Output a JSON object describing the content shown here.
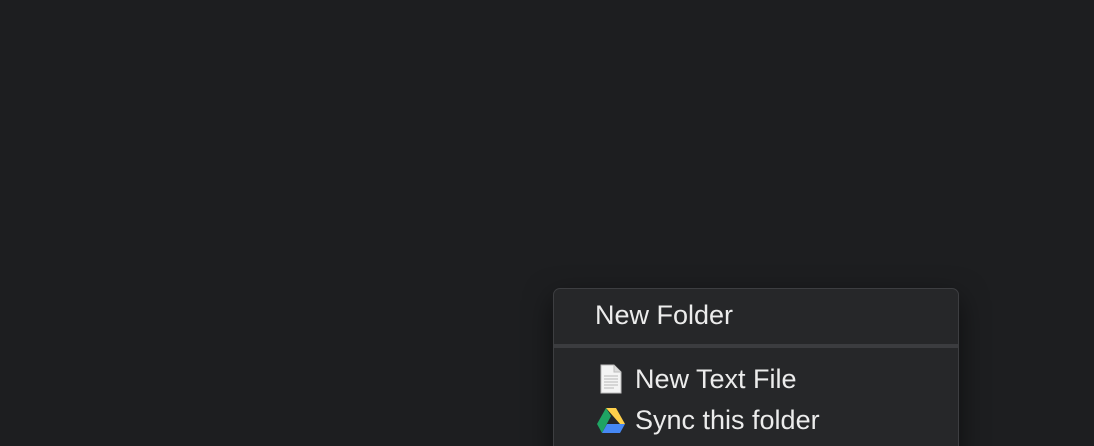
{
  "desktop": {
    "background_color": "#1d1e20"
  },
  "context_menu": {
    "items": [
      {
        "label": "New Folder",
        "icon": null
      },
      {
        "label": "New Text File",
        "icon": "document-icon"
      },
      {
        "label": "Sync this folder",
        "icon": "google-drive-icon"
      }
    ],
    "colors": {
      "menu_background": "#262729",
      "text": "#ececec",
      "separator": "#3b3c3f",
      "drive_green": "#1fa463",
      "drive_yellow": "#ffd04b",
      "drive_blue": "#4688f4"
    }
  }
}
